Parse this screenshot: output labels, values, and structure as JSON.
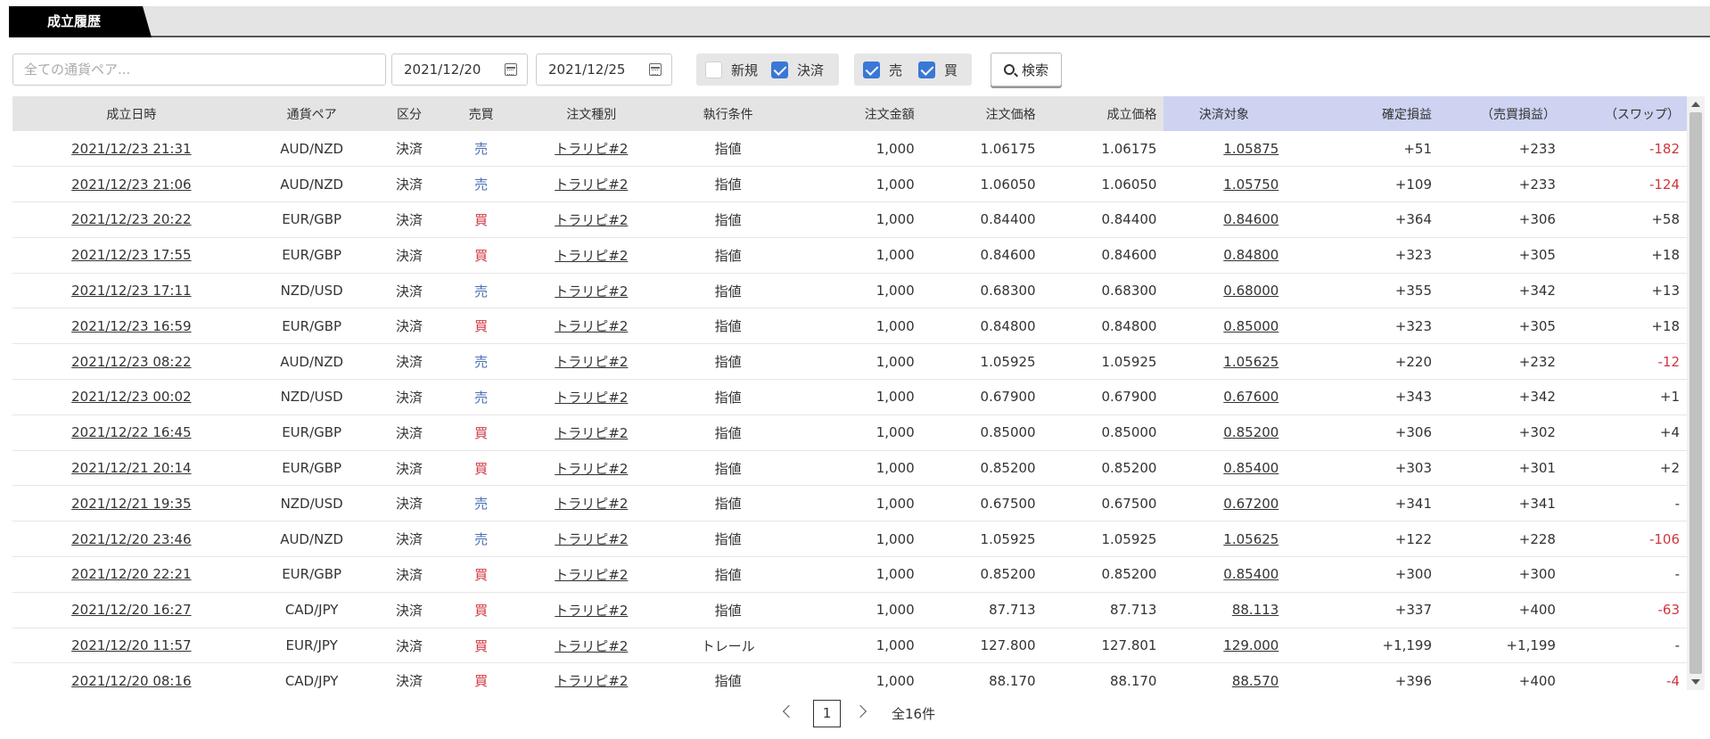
{
  "tab": {
    "label": "成立履歴"
  },
  "filters": {
    "pair_placeholder": "全ての通貨ペア...",
    "date_from": "2021/12/20",
    "date_to": "2021/12/25",
    "type_new": {
      "label": "新規",
      "checked": false
    },
    "type_settle": {
      "label": "決済",
      "checked": true
    },
    "side_sell": {
      "label": "売",
      "checked": true
    },
    "side_buy": {
      "label": "買",
      "checked": true
    },
    "search_label": "検索"
  },
  "table": {
    "headers": [
      "成立日時",
      "通貨ペア",
      "区分",
      "売買",
      "注文種別",
      "執行条件",
      "注文金額",
      "注文価格",
      "成立価格",
      "決済対象",
      "確定損益",
      "（売買損益）",
      "（スワップ）"
    ],
    "rows": [
      [
        "2021/12/23 21:31",
        "AUD/NZD",
        "決済",
        "売",
        "トラリピ#2",
        "指値",
        "1,000",
        "1.06175",
        "1.06175",
        "1.05875",
        "+51",
        "+233",
        "-182"
      ],
      [
        "2021/12/23 21:06",
        "AUD/NZD",
        "決済",
        "売",
        "トラリピ#2",
        "指値",
        "1,000",
        "1.06050",
        "1.06050",
        "1.05750",
        "+109",
        "+233",
        "-124"
      ],
      [
        "2021/12/23 20:22",
        "EUR/GBP",
        "決済",
        "買",
        "トラリピ#2",
        "指値",
        "1,000",
        "0.84400",
        "0.84400",
        "0.84600",
        "+364",
        "+306",
        "+58"
      ],
      [
        "2021/12/23 17:55",
        "EUR/GBP",
        "決済",
        "買",
        "トラリピ#2",
        "指値",
        "1,000",
        "0.84600",
        "0.84600",
        "0.84800",
        "+323",
        "+305",
        "+18"
      ],
      [
        "2021/12/23 17:11",
        "NZD/USD",
        "決済",
        "売",
        "トラリピ#2",
        "指値",
        "1,000",
        "0.68300",
        "0.68300",
        "0.68000",
        "+355",
        "+342",
        "+13"
      ],
      [
        "2021/12/23 16:59",
        "EUR/GBP",
        "決済",
        "買",
        "トラリピ#2",
        "指値",
        "1,000",
        "0.84800",
        "0.84800",
        "0.85000",
        "+323",
        "+305",
        "+18"
      ],
      [
        "2021/12/23 08:22",
        "AUD/NZD",
        "決済",
        "売",
        "トラリピ#2",
        "指値",
        "1,000",
        "1.05925",
        "1.05925",
        "1.05625",
        "+220",
        "+232",
        "-12"
      ],
      [
        "2021/12/23 00:02",
        "NZD/USD",
        "決済",
        "売",
        "トラリピ#2",
        "指値",
        "1,000",
        "0.67900",
        "0.67900",
        "0.67600",
        "+343",
        "+342",
        "+1"
      ],
      [
        "2021/12/22 16:45",
        "EUR/GBP",
        "決済",
        "買",
        "トラリピ#2",
        "指値",
        "1,000",
        "0.85000",
        "0.85000",
        "0.85200",
        "+306",
        "+302",
        "+4"
      ],
      [
        "2021/12/21 20:14",
        "EUR/GBP",
        "決済",
        "買",
        "トラリピ#2",
        "指値",
        "1,000",
        "0.85200",
        "0.85200",
        "0.85400",
        "+303",
        "+301",
        "+2"
      ],
      [
        "2021/12/21 19:35",
        "NZD/USD",
        "決済",
        "売",
        "トラリピ#2",
        "指値",
        "1,000",
        "0.67500",
        "0.67500",
        "0.67200",
        "+341",
        "+341",
        "-"
      ],
      [
        "2021/12/20 23:46",
        "AUD/NZD",
        "決済",
        "売",
        "トラリピ#2",
        "指値",
        "1,000",
        "1.05925",
        "1.05925",
        "1.05625",
        "+122",
        "+228",
        "-106"
      ],
      [
        "2021/12/20 22:21",
        "EUR/GBP",
        "決済",
        "買",
        "トラリピ#2",
        "指値",
        "1,000",
        "0.85200",
        "0.85200",
        "0.85400",
        "+300",
        "+300",
        "-"
      ],
      [
        "2021/12/20 16:27",
        "CAD/JPY",
        "決済",
        "買",
        "トラリピ#2",
        "指値",
        "1,000",
        "87.713",
        "87.713",
        "88.113",
        "+337",
        "+400",
        "-63"
      ],
      [
        "2021/12/20 11:57",
        "EUR/JPY",
        "決済",
        "買",
        "トラリピ#2",
        "トレール",
        "1,000",
        "127.800",
        "127.801",
        "129.000",
        "+1,199",
        "+1,199",
        "-"
      ],
      [
        "2021/12/20 08:16",
        "CAD/JPY",
        "決済",
        "買",
        "トラリピ#2",
        "指値",
        "1,000",
        "88.170",
        "88.170",
        "88.570",
        "+396",
        "+400",
        "-4"
      ]
    ]
  },
  "pagination": {
    "current": "1",
    "total_label": "全16件"
  },
  "colors": {
    "sell": "#4a6fb5",
    "buy": "#d0353f",
    "negative": "#d0353f",
    "header_highlight": "#cdd3f0",
    "checkbox_on": "#3a78d6"
  }
}
